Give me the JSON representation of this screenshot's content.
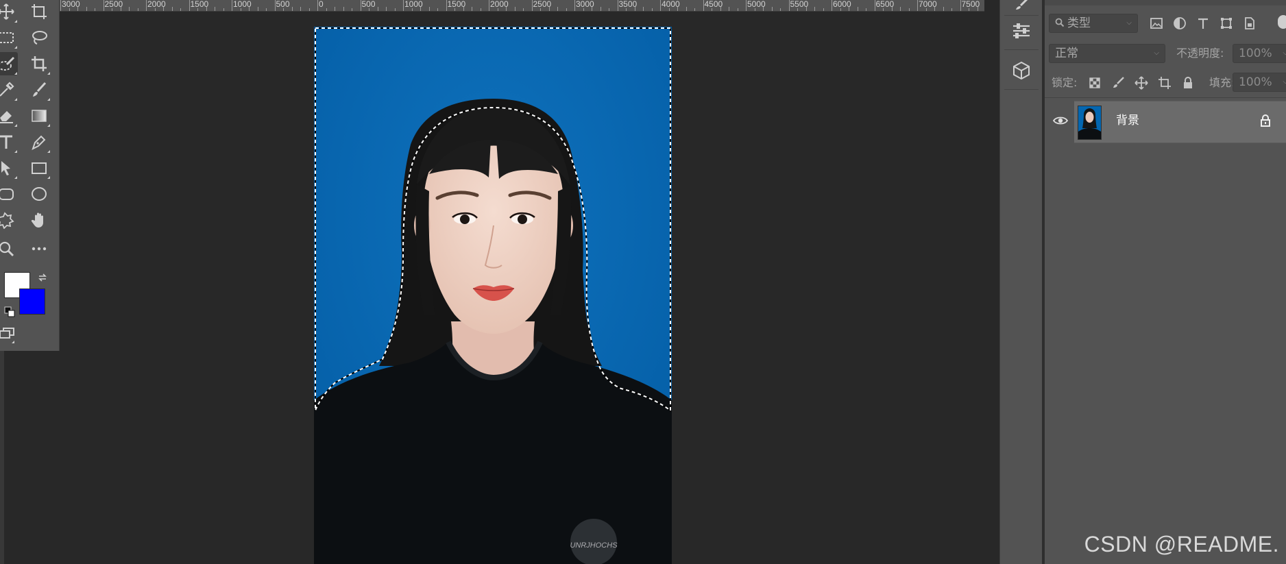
{
  "ruler": {
    "labels": [
      "3000",
      "2500",
      "2000",
      "1500",
      "1000",
      "500",
      "0",
      "500",
      "1000",
      "1500",
      "2000",
      "2500",
      "3000",
      "3500",
      "4000",
      "4500",
      "5000",
      "5500",
      "6000",
      "6500",
      "7000",
      "7500"
    ]
  },
  "toolbar": {
    "tools": [
      {
        "name": "move-tool",
        "icon": "move-icon"
      },
      {
        "name": "artboard-tool",
        "icon": "artboard-icon"
      },
      {
        "name": "marquee-tool",
        "icon": "rect-marquee-icon"
      },
      {
        "name": "lasso-tool",
        "icon": "lasso-icon"
      },
      {
        "name": "quick-selection-tool",
        "icon": "quick-select-icon",
        "active": true
      },
      {
        "name": "crop-tool",
        "icon": "crop-icon"
      },
      {
        "name": "eyedropper-tool",
        "icon": "eyedropper-icon"
      },
      {
        "name": "brush-tool",
        "icon": "brush-icon"
      },
      {
        "name": "eraser-tool",
        "icon": "eraser-icon"
      },
      {
        "name": "gradient-tool",
        "icon": "gradient-icon"
      },
      {
        "name": "type-tool",
        "icon": "type-icon"
      },
      {
        "name": "pen-tool",
        "icon": "pen-icon"
      },
      {
        "name": "path-selection-tool",
        "icon": "arrow-icon"
      },
      {
        "name": "rectangle-tool",
        "icon": "rectangle-icon"
      },
      {
        "name": "rounded-rect-tool",
        "icon": "rounded-rect-icon"
      },
      {
        "name": "ellipse-tool",
        "icon": "ellipse-icon"
      },
      {
        "name": "custom-shape-tool",
        "icon": "puzzle-icon"
      },
      {
        "name": "hand-tool",
        "icon": "hand-icon"
      },
      {
        "name": "zoom-tool",
        "icon": "zoom-icon"
      },
      {
        "name": "more-tools",
        "icon": "ellipsis-icon"
      }
    ],
    "foreground_color": "#ffffff",
    "background_color": "#0000ff"
  },
  "document": {
    "background_color": "#0466b0",
    "shirt_text": "UNRJHOCHS"
  },
  "layers_panel": {
    "filter_label": "类型",
    "blend_mode": "正常",
    "opacity_label": "不透明度:",
    "opacity_value": "100%",
    "lock_label": "锁定:",
    "fill_label": "填充:",
    "fill_value": "100%",
    "layers": [
      {
        "name": "背景",
        "visible": true,
        "locked": true
      }
    ]
  },
  "watermark": "CSDN @README."
}
